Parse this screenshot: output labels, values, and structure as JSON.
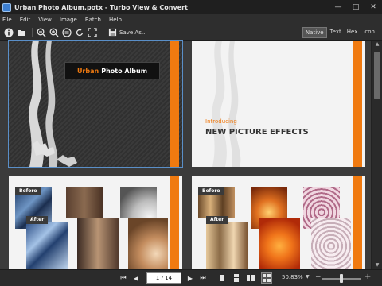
{
  "window": {
    "title": "Urban Photo Album.potx - Turbo View & Convert"
  },
  "menu": [
    "File",
    "Edit",
    "View",
    "Image",
    "Batch",
    "Help"
  ],
  "toolbar": {
    "save_as_label": "Save As..."
  },
  "view_tabs": [
    "Native",
    "Text",
    "Hex",
    "Icon"
  ],
  "slides": {
    "s1": {
      "title_a": "Urban",
      "title_b": "Photo Album"
    },
    "s2": {
      "intro": "Introducing",
      "headline": "NEW PICTURE EFFECTS"
    },
    "s3": {
      "before": "Before",
      "after": "After"
    },
    "s4": {
      "before": "Before",
      "after": "After"
    }
  },
  "status": {
    "page": "1 / 14",
    "zoom": "50.83%"
  },
  "colors": {
    "accent": "#f07a10",
    "selection": "#5a8fc8"
  }
}
